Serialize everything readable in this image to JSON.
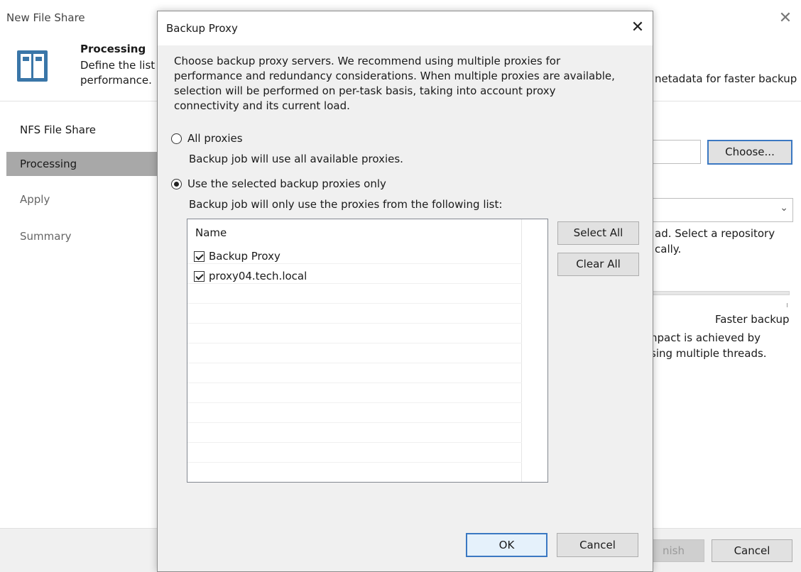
{
  "wizard": {
    "title": "New File Share",
    "close_glyph": "✕",
    "header_title": "Processing",
    "header_desc_line1": "Define the list",
    "header_desc_line2": "performance.",
    "header_desc_right": "netadata for faster backup",
    "steps": [
      "NFS File Share",
      "Processing",
      "Apply",
      "Summary"
    ],
    "choose_label": "Choose...",
    "repo_text_1": "ad. Select a repository",
    "repo_text_2": "cally.",
    "faster_backup": "Faster backup",
    "impact_1": "npact is achieved by",
    "impact_2": "sing multiple threads.",
    "finish_label": "nish",
    "cancel_label": "Cancel"
  },
  "dialog": {
    "title": "Backup Proxy",
    "close_glyph": "✕",
    "description_lines": [
      "Choose backup proxy servers. We recommend using multiple proxies for",
      "performance and redundancy considerations. When multiple proxies are available,",
      "selection will be performed on per-task basis, taking into account proxy",
      "connectivity and its current load."
    ],
    "option_all_label": "All proxies",
    "option_all_hint": "Backup job will use all available proxies.",
    "option_selected_label": "Use the selected backup proxies only",
    "option_selected_hint": "Backup job will only use the proxies from the following list:",
    "list": {
      "column_name": "Name",
      "items": [
        {
          "label": "Backup Proxy",
          "checked": true
        },
        {
          "label": "proxy04.tech.local",
          "checked": true
        }
      ]
    },
    "select_all_label": "Select All",
    "clear_all_label": "Clear All",
    "ok_label": "OK",
    "cancel_label": "Cancel"
  },
  "colors": {
    "accent": "#3b78c2",
    "logo": "#3a76a8",
    "active_step": "#a8a8a8"
  }
}
